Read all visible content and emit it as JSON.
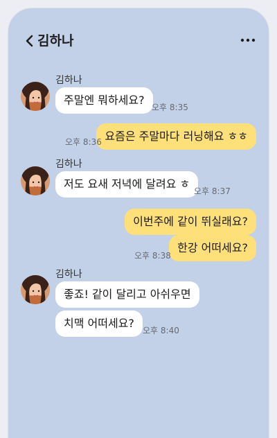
{
  "header": {
    "title": "김하나",
    "back_icon": "chevron-left-icon",
    "more_icon": "more-horizontal-icon"
  },
  "messages": [
    {
      "sender": "김하나",
      "text": "주말엔 뭐하세요?",
      "time": "오후 8:35",
      "side": "in"
    },
    {
      "text": "요즘은 주말마다 러닝해요 ㅎㅎ",
      "time": "오후 8:36",
      "side": "out"
    },
    {
      "sender": "김하나",
      "text": "저도 요새 저녁에 달려요 ㅎ",
      "time": "오후 8:37",
      "side": "in"
    },
    {
      "text": "이번주에 같이 뛰실래요?",
      "side": "out"
    },
    {
      "text": "한강 어떠세요?",
      "time": "오후 8:38",
      "side": "out"
    },
    {
      "sender": "김하나",
      "text": "좋죠! 같이 달리고 아쉬우면",
      "side": "in"
    },
    {
      "text": "치맥 어떠세요?",
      "time": "오후 8:40",
      "side": "in"
    }
  ],
  "colors": {
    "background": "#c3d1e8",
    "incoming_bubble": "#ffffff",
    "outgoing_bubble": "#fde07a"
  }
}
